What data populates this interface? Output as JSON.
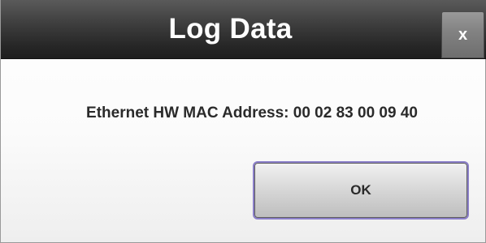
{
  "dialog": {
    "title": "Log Data",
    "close_label": "x",
    "message": "Ethernet HW MAC Address: 00 02 83 00 09 40",
    "ok_label": "OK"
  },
  "colors": {
    "titlebar": "#2e2e2e",
    "title_text": "#ffffff",
    "message_text": "#2a2a2a",
    "ok_focus_border": "#8b7fc9"
  }
}
